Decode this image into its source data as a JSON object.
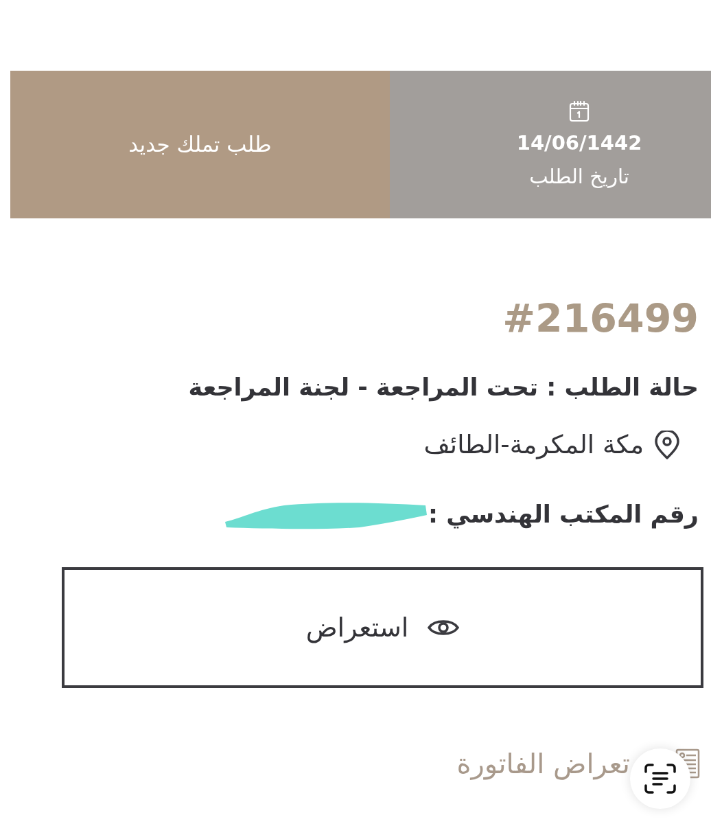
{
  "request_summary": {
    "type_label": "طلب تملك جديد",
    "date": "14/06/1442",
    "date_label": "تاريخ الطلب"
  },
  "request": {
    "number": "#216499",
    "status": "حالة الطلب : تحت المراجعة - لجنة المراجعة",
    "location": "مكة المكرمة-الطائف",
    "office_number_label": "رقم المكتب الهندسي :",
    "office_number_redacted": true
  },
  "view_button": {
    "label": "استعراض"
  },
  "invoice_link": {
    "label": "تعراض الفاتورة"
  }
}
